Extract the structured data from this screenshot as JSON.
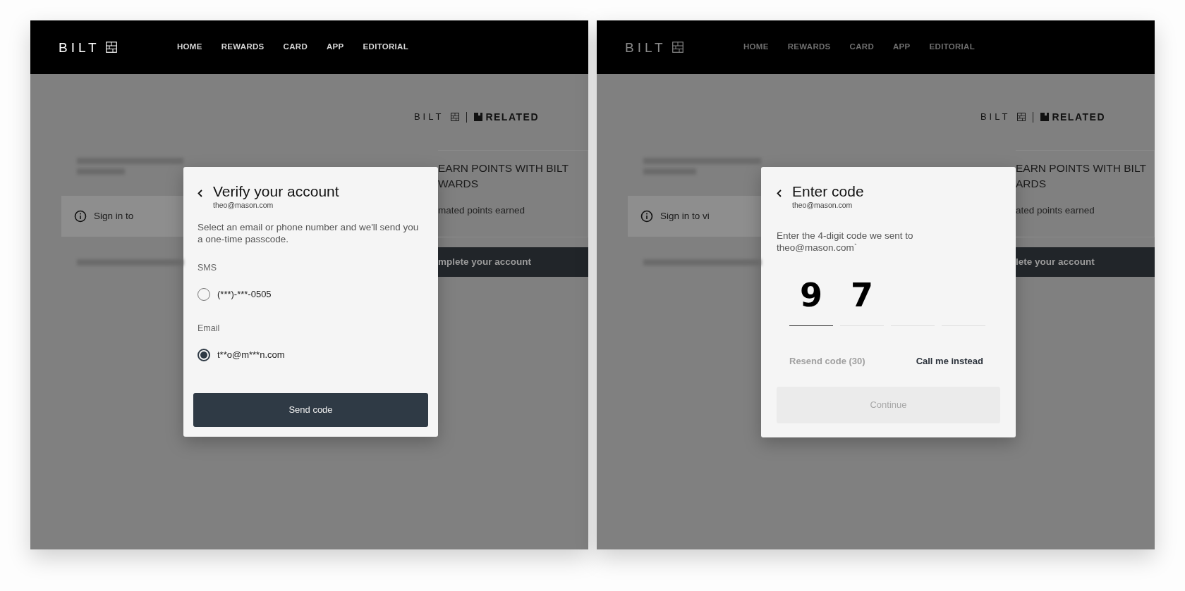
{
  "panels": [
    {
      "navbar": {
        "logo": "BILT",
        "dimmed": false,
        "links": [
          "HOME",
          "REWARDS",
          "CARD",
          "APP",
          "EDITORIAL"
        ]
      },
      "partner_logos": {
        "first": "BILT",
        "second": "RELATED"
      },
      "background": {
        "notice": "Sign in to",
        "card_title_lines": [
          "EARN POINTS WITH BILT",
          "WARDS"
        ],
        "card_text": "mated points earned",
        "card_button": "mplete your account"
      },
      "dialog": {
        "kind": "choose_method",
        "title": "Verify your account",
        "subtitle": "theo@mason.com",
        "description": "Select an email or phone number and we'll send you a one-time passcode.",
        "groups": [
          {
            "label": "SMS",
            "options": [
              {
                "label": "(***)-***-0505",
                "selected": false
              }
            ]
          },
          {
            "label": "Email",
            "options": [
              {
                "label": "t**o@m***n.com",
                "selected": true
              }
            ]
          }
        ],
        "button": {
          "label": "Send code",
          "disabled": false
        }
      }
    },
    {
      "navbar": {
        "logo": "BILT",
        "dimmed": true,
        "links": [
          "HOME",
          "REWARDS",
          "CARD",
          "APP",
          "EDITORIAL"
        ]
      },
      "partner_logos": {
        "first": "BILT",
        "second": "RELATED"
      },
      "background": {
        "notice": "Sign in to vi",
        "card_title_lines": [
          "EARN POINTS WITH BILT",
          "ARDS"
        ],
        "card_text": "ated points earned",
        "card_button": "lete your account"
      },
      "dialog": {
        "kind": "enter_code",
        "title": "Enter code",
        "subtitle": "theo@mason.com",
        "description": "Enter the 4-digit code we sent to theo@mason.com`",
        "digits": [
          {
            "value": "9",
            "selected": true
          },
          {
            "value": "7",
            "selected": false
          },
          {
            "selected": false
          },
          {
            "selected": false
          }
        ],
        "links": [
          {
            "label": "Resend code (30)",
            "disabled": true
          },
          {
            "label": "Call me instead",
            "disabled": false
          }
        ],
        "button": {
          "label": "Continue",
          "disabled": true
        }
      }
    }
  ]
}
